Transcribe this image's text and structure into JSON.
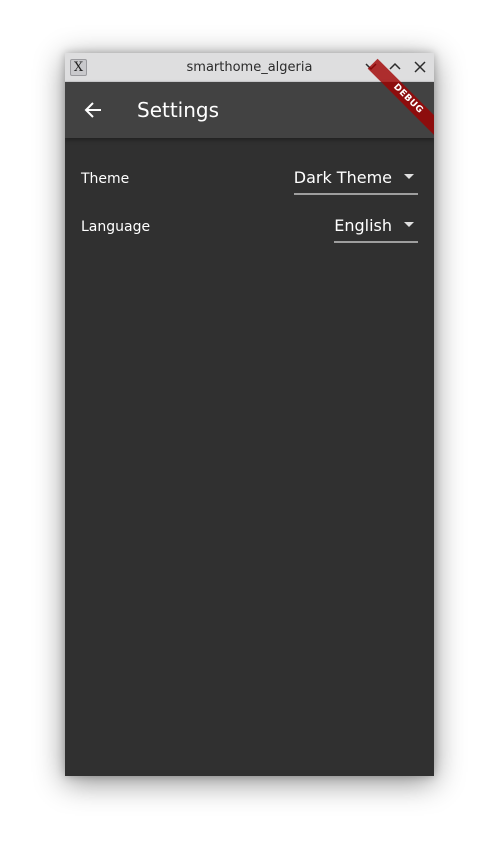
{
  "window": {
    "title": "smarthome_algeria",
    "app_icon_glyph": "X",
    "controls": [
      "minimize",
      "maximize",
      "close"
    ]
  },
  "appbar": {
    "title": "Settings",
    "back_icon": "arrow-left-icon",
    "debug_banner": "DEBUG"
  },
  "settings": {
    "theme": {
      "label": "Theme",
      "value": "Dark Theme"
    },
    "language": {
      "label": "Language",
      "value": "English"
    }
  },
  "colors": {
    "background": "#303030",
    "appbar": "#424242",
    "titlebar": "#dededf",
    "text": "#ffffff",
    "debug_banner": "#a00000"
  }
}
